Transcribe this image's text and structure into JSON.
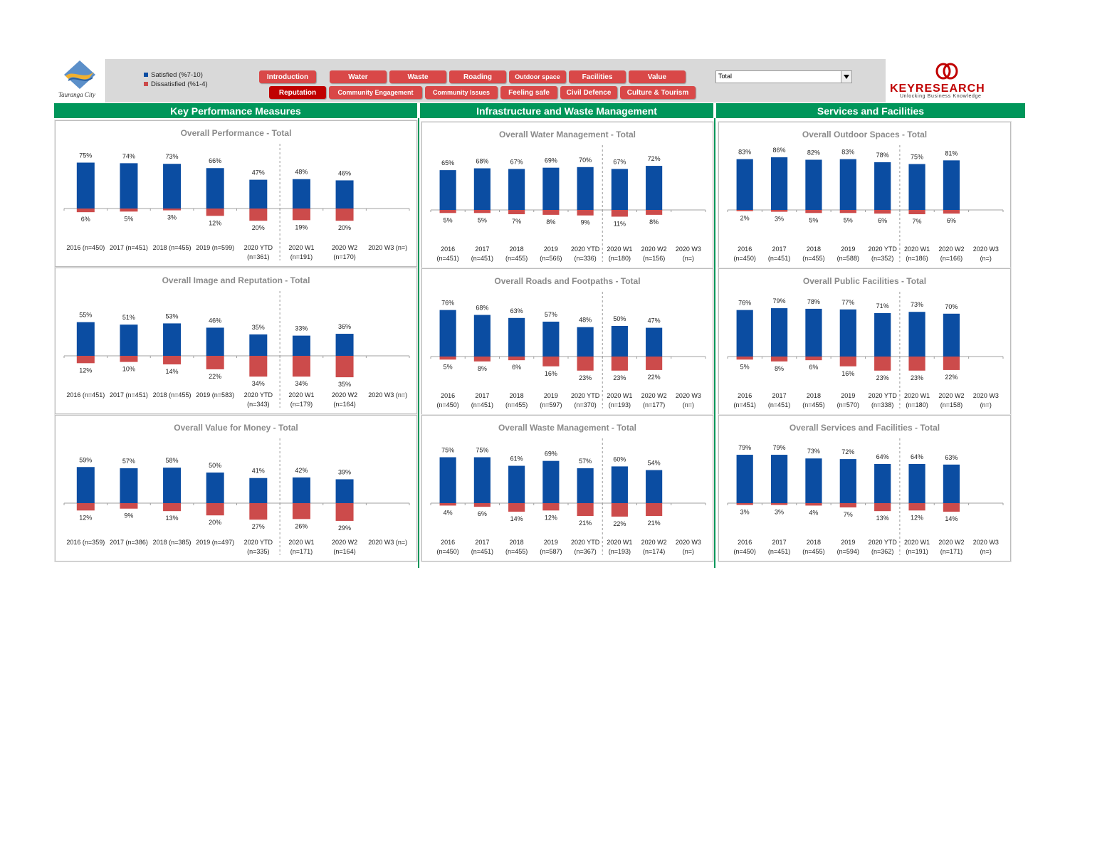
{
  "header": {
    "logo_text": "Tauranga City",
    "legend": [
      {
        "label": "Satisfied (%7-10)",
        "color": "#0b4da2"
      },
      {
        "label": "Dissatisfied (%1-4)",
        "color": "#cc4b4b"
      }
    ],
    "nav_row1": [
      "Introduction",
      "Water",
      "Waste",
      "Roading",
      "Outdoor space",
      "Facilities",
      "Value"
    ],
    "nav_row2": [
      "Reputation",
      "Community Engagement",
      "Community Issues",
      "Feeling safe",
      "Civil Defence",
      "Culture & Tourism"
    ],
    "active_tab": "Reputation",
    "dropdown_value": "Total",
    "brand_name": "KEYRESEARCH",
    "brand_tagline": "Unlocking Business Knowledge"
  },
  "sections": [
    "Key Performance Measures",
    "Infrastructure and Waste Management",
    "Services and Facilities"
  ],
  "colors": {
    "satisfied": "#0b4da2",
    "dissatisfied": "#cc4b4b",
    "green": "#00965a",
    "accent_red": "#d94848"
  },
  "chart_data": [
    {
      "type": "bar",
      "title": "Overall Performance - Total",
      "categories": [
        [
          "2016 (n=450)"
        ],
        [
          "2017 (n=451)"
        ],
        [
          "2018 (n=455)"
        ],
        [
          "2019 (n=599)"
        ],
        [
          "2020 YTD",
          "(n=361)"
        ],
        [
          "2020 W1",
          "(n=191)"
        ],
        [
          "2020 W2",
          "(n=170)"
        ],
        [
          "2020 W3 (n=)"
        ]
      ],
      "series": [
        {
          "name": "Satisfied (%7-10)",
          "values": [
            75,
            74,
            73,
            66,
            47,
            48,
            46,
            null
          ]
        },
        {
          "name": "Dissatisfied (%1-4)",
          "values": [
            6,
            5,
            3,
            12,
            20,
            19,
            20,
            null
          ]
        }
      ]
    },
    {
      "type": "bar",
      "title": "Overall Image and Reputation - Total",
      "categories": [
        [
          "2016 (n=451)"
        ],
        [
          "2017 (n=451)"
        ],
        [
          "2018 (n=455)"
        ],
        [
          "2019 (n=583)"
        ],
        [
          "2020 YTD",
          "(n=343)"
        ],
        [
          "2020 W1",
          "(n=179)"
        ],
        [
          "2020 W2",
          "(n=164)"
        ],
        [
          "2020 W3 (n=)"
        ]
      ],
      "series": [
        {
          "name": "Satisfied (%7-10)",
          "values": [
            55,
            51,
            53,
            46,
            35,
            33,
            36,
            null
          ]
        },
        {
          "name": "Dissatisfied (%1-4)",
          "values": [
            12,
            10,
            14,
            22,
            34,
            34,
            35,
            null
          ]
        }
      ]
    },
    {
      "type": "bar",
      "title": "Overall Value for Money - Total",
      "categories": [
        [
          "2016 (n=359)"
        ],
        [
          "2017 (n=386)"
        ],
        [
          "2018 (n=385)"
        ],
        [
          "2019 (n=497)"
        ],
        [
          "2020 YTD",
          "(n=335)"
        ],
        [
          "2020 W1",
          "(n=171)"
        ],
        [
          "2020 W2",
          "(n=164)"
        ],
        [
          "2020 W3 (n=)"
        ]
      ],
      "series": [
        {
          "name": "Satisfied (%7-10)",
          "values": [
            59,
            57,
            58,
            50,
            41,
            42,
            39,
            null
          ]
        },
        {
          "name": "Dissatisfied (%1-4)",
          "values": [
            12,
            9,
            13,
            20,
            27,
            26,
            29,
            null
          ]
        }
      ]
    },
    {
      "type": "bar",
      "title": "Overall Water Management - Total",
      "categories": [
        [
          "2016",
          "(n=451)"
        ],
        [
          "2017",
          "(n=451)"
        ],
        [
          "2018",
          "(n=455)"
        ],
        [
          "2019",
          "(n=566)"
        ],
        [
          "2020 YTD",
          "(n=336)"
        ],
        [
          "2020 W1",
          "(n=180)"
        ],
        [
          "2020 W2",
          "(n=156)"
        ],
        [
          "2020 W3",
          "(n=)"
        ]
      ],
      "series": [
        {
          "name": "Satisfied (%7-10)",
          "values": [
            65,
            68,
            67,
            69,
            70,
            67,
            72,
            null
          ]
        },
        {
          "name": "Dissatisfied (%1-4)",
          "values": [
            5,
            5,
            7,
            8,
            9,
            11,
            8,
            null
          ]
        }
      ]
    },
    {
      "type": "bar",
      "title": "Overall Roads and Footpaths - Total",
      "categories": [
        [
          "2016",
          "(n=450)"
        ],
        [
          "2017",
          "(n=451)"
        ],
        [
          "2018",
          "(n=455)"
        ],
        [
          "2019",
          "(n=597)"
        ],
        [
          "2020 YTD",
          "(n=370)"
        ],
        [
          "2020 W1",
          "(n=193)"
        ],
        [
          "2020 W2",
          "(n=177)"
        ],
        [
          "2020 W3",
          "(n=)"
        ]
      ],
      "series": [
        {
          "name": "Satisfied (%7-10)",
          "values": [
            76,
            68,
            63,
            57,
            48,
            50,
            47,
            null
          ]
        },
        {
          "name": "Dissatisfied (%1-4)",
          "values": [
            5,
            8,
            6,
            16,
            23,
            23,
            22,
            null
          ]
        }
      ]
    },
    {
      "type": "bar",
      "title": "Overall Waste Management - Total",
      "categories": [
        [
          "2016",
          "(n=450)"
        ],
        [
          "2017",
          "(n=451)"
        ],
        [
          "2018",
          "(n=455)"
        ],
        [
          "2019",
          "(n=587)"
        ],
        [
          "2020 YTD",
          "(n=367)"
        ],
        [
          "2020 W1",
          "(n=193)"
        ],
        [
          "2020 W2",
          "(n=174)"
        ],
        [
          "2020 W3",
          "(n=)"
        ]
      ],
      "series": [
        {
          "name": "Satisfied (%7-10)",
          "values": [
            75,
            75,
            61,
            69,
            57,
            60,
            54,
            null
          ]
        },
        {
          "name": "Dissatisfied (%1-4)",
          "values": [
            4,
            6,
            14,
            12,
            21,
            22,
            21,
            null
          ]
        }
      ]
    },
    {
      "type": "bar",
      "title": "Overall Outdoor Spaces - Total",
      "categories": [
        [
          "2016",
          "(n=450)"
        ],
        [
          "2017",
          "(n=451)"
        ],
        [
          "2018",
          "(n=455)"
        ],
        [
          "2019",
          "(n=588)"
        ],
        [
          "2020 YTD",
          "(n=352)"
        ],
        [
          "2020 W1",
          "(n=186)"
        ],
        [
          "2020 W2",
          "(n=166)"
        ],
        [
          "2020 W3",
          "(n=)"
        ]
      ],
      "series": [
        {
          "name": "Satisfied (%7-10)",
          "values": [
            83,
            86,
            82,
            83,
            78,
            75,
            81,
            null
          ]
        },
        {
          "name": "Dissatisfied (%1-4)",
          "values": [
            2,
            3,
            5,
            5,
            6,
            7,
            6,
            null
          ]
        }
      ]
    },
    {
      "type": "bar",
      "title": "Overall Public Facilities - Total",
      "categories": [
        [
          "2016",
          "(n=451)"
        ],
        [
          "2017",
          "(n=451)"
        ],
        [
          "2018",
          "(n=455)"
        ],
        [
          "2019",
          "(n=570)"
        ],
        [
          "2020 YTD",
          "(n=338)"
        ],
        [
          "2020 W1",
          "(n=180)"
        ],
        [
          "2020 W2",
          "(n=158)"
        ],
        [
          "2020 W3",
          "(n=)"
        ]
      ],
      "series": [
        {
          "name": "Satisfied (%7-10)",
          "values": [
            76,
            79,
            78,
            77,
            71,
            73,
            70,
            null
          ]
        },
        {
          "name": "Dissatisfied (%1-4)",
          "values": [
            5,
            8,
            6,
            16,
            23,
            23,
            22,
            null
          ]
        }
      ]
    },
    {
      "type": "bar",
      "title": "Overall Services and Facilities - Total",
      "categories": [
        [
          "2016",
          "(n=450)"
        ],
        [
          "2017",
          "(n=451)"
        ],
        [
          "2018",
          "(n=455)"
        ],
        [
          "2019",
          "(n=594)"
        ],
        [
          "2020 YTD",
          "(n=362)"
        ],
        [
          "2020 W1",
          "(n=191)"
        ],
        [
          "2020 W2",
          "(n=171)"
        ],
        [
          "2020 W3",
          "(n=)"
        ]
      ],
      "series": [
        {
          "name": "Satisfied (%7-10)",
          "values": [
            79,
            79,
            73,
            72,
            64,
            64,
            63,
            null
          ]
        },
        {
          "name": "Dissatisfied (%1-4)",
          "values": [
            3,
            3,
            4,
            7,
            13,
            12,
            14,
            null
          ]
        }
      ]
    }
  ]
}
